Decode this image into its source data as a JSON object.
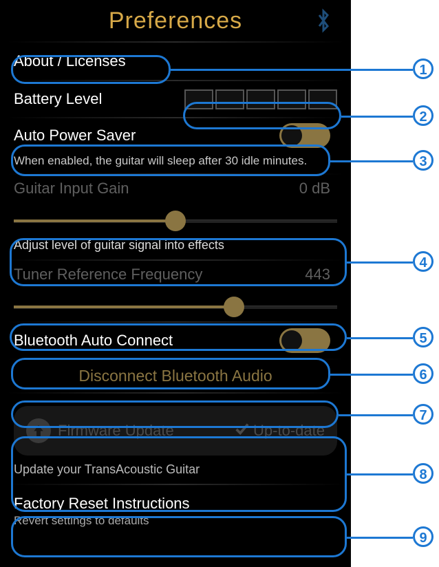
{
  "header": {
    "title": "Preferences",
    "bt_icon": "bluetooth-icon"
  },
  "about": {
    "label": "About / Licenses"
  },
  "battery": {
    "label": "Battery Level",
    "segments": 5
  },
  "aps": {
    "label": "Auto Power Saver",
    "desc": "When enabled, the guitar will sleep after 30 idle minutes."
  },
  "gain": {
    "label": "Guitar Input Gain",
    "value": "0 dB",
    "hint": "Adjust level of guitar signal into effects",
    "percent": 50
  },
  "tuner": {
    "label": "Tuner Reference Frequency",
    "value": "443",
    "percent": 68
  },
  "bac": {
    "label": "Bluetooth Auto Connect"
  },
  "disconnect": {
    "label": "Disconnect Bluetooth Audio"
  },
  "fw": {
    "label": "Firmware Update",
    "status": "Up-to-date",
    "sub": "Update your TransAcoustic Guitar"
  },
  "factory": {
    "title": "Factory Reset Instructions",
    "sub": "Revert settings to defaults"
  },
  "callouts": [
    "1",
    "2",
    "3",
    "4",
    "5",
    "6",
    "7",
    "8",
    "9"
  ]
}
